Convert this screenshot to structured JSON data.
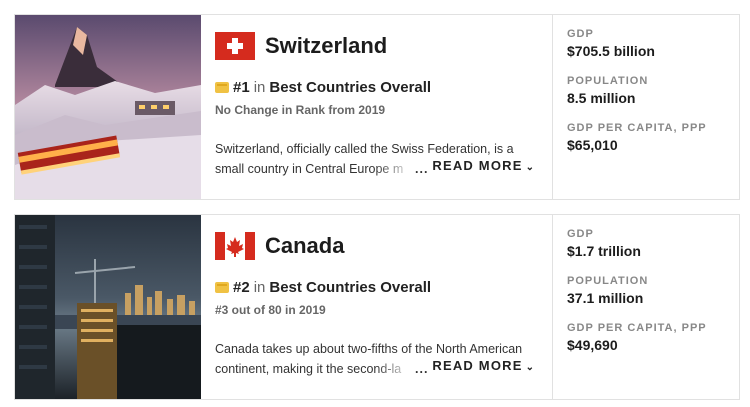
{
  "cards": [
    {
      "country": "Switzerland",
      "flag_icon": "swiss-flag",
      "rank_prefix": "#1",
      "rank_in": "in",
      "rank_list": "Best Countries Overall",
      "rank_change": "No Change in Rank from 2019",
      "desc_line1": "Switzerland, officially called the Swiss Federation, is a",
      "desc_line2": "small country in Central Europe m",
      "ellipsis": "...",
      "read_more": "READ MORE",
      "stats": [
        {
          "label": "GDP",
          "value": "$705.5 billion"
        },
        {
          "label": "POPULATION",
          "value": "8.5 million"
        },
        {
          "label": "GDP PER CAPITA, PPP",
          "value": "$65,010"
        }
      ]
    },
    {
      "country": "Canada",
      "flag_icon": "canada-flag",
      "rank_prefix": "#2",
      "rank_in": "in",
      "rank_list": "Best Countries Overall",
      "rank_change": "#3 out of 80 in 2019",
      "desc_line1": "Canada takes up about two-fifths of the North American",
      "desc_line2": "continent, making it the second-la",
      "ellipsis": "...",
      "read_more": "READ MORE",
      "stats": [
        {
          "label": "GDP",
          "value": "$1.7 trillion"
        },
        {
          "label": "POPULATION",
          "value": "37.1 million"
        },
        {
          "label": "GDP PER CAPITA, PPP",
          "value": "$49,690"
        }
      ]
    }
  ],
  "colors": {
    "swiss_red": "#d52b1e",
    "canada_red": "#d52b1e",
    "medal_gold": "#f0c244"
  }
}
